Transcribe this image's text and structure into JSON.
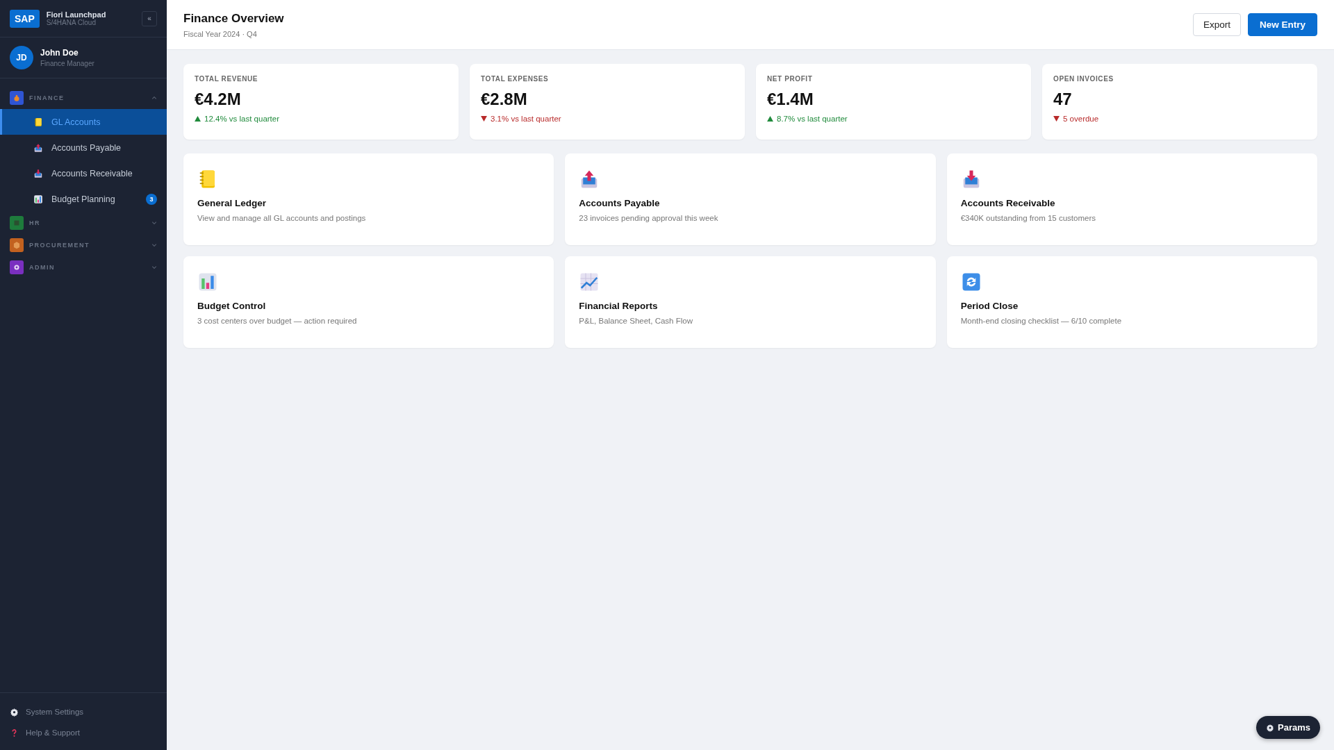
{
  "brand": {
    "logo": "SAP",
    "title": "Fiori Launchpad",
    "subtitle": "S/4HANA Cloud",
    "collapse": "«"
  },
  "user": {
    "initials": "JD",
    "name": "John Doe",
    "role": "Finance Manager"
  },
  "nav": [
    {
      "label": "FINANCE",
      "color": "#2f55d4",
      "expanded": true,
      "children": [
        {
          "label": "GL Accounts",
          "selected": true
        },
        {
          "label": "Accounts Payable",
          "selected": false
        },
        {
          "label": "Accounts Receivable",
          "selected": false
        },
        {
          "label": "Budget Planning",
          "selected": false,
          "badge": "3"
        }
      ]
    },
    {
      "label": "HR",
      "color": "#1e7b3c",
      "expanded": false
    },
    {
      "label": "PROCUREMENT",
      "color": "#c2611f",
      "expanded": false
    },
    {
      "label": "ADMIN",
      "color": "#7a2fc0",
      "expanded": false
    }
  ],
  "sidebar_footer": [
    {
      "label": "System Settings"
    },
    {
      "label": "Help & Support"
    }
  ],
  "header": {
    "title": "Finance Overview",
    "subtitle": "Fiscal Year 2024 · Q4",
    "buttons": [
      {
        "label": "Export",
        "kind": "secondary"
      },
      {
        "label": "New Entry",
        "kind": "primary"
      }
    ]
  },
  "kpis": [
    {
      "label": "TOTAL REVENUE",
      "value": "€4.2M",
      "positive": true,
      "note": "12.4% vs last quarter"
    },
    {
      "label": "TOTAL EXPENSES",
      "value": "€2.8M",
      "positive": false,
      "note": "3.1% vs last quarter"
    },
    {
      "label": "NET PROFIT",
      "value": "€1.4M",
      "positive": true,
      "note": "8.7% vs last quarter"
    },
    {
      "label": "OPEN INVOICES",
      "value": "47",
      "positive": false,
      "note": "5 overdue"
    }
  ],
  "tiles": [
    {
      "title": "General Ledger",
      "description": "View and manage all GL accounts and postings"
    },
    {
      "title": "Accounts Payable",
      "description": "23 invoices pending approval this week"
    },
    {
      "title": "Accounts Receivable",
      "description": "€340K outstanding from 15 customers"
    },
    {
      "title": "Budget Control",
      "description": "3 cost centers over budget — action required"
    },
    {
      "title": "Financial Reports",
      "description": "P&L, Balance Sheet, Cash Flow"
    },
    {
      "title": "Period Close",
      "description": "Month-end closing checklist — 6/10 complete"
    }
  ],
  "params_button": {
    "label": "Params"
  }
}
